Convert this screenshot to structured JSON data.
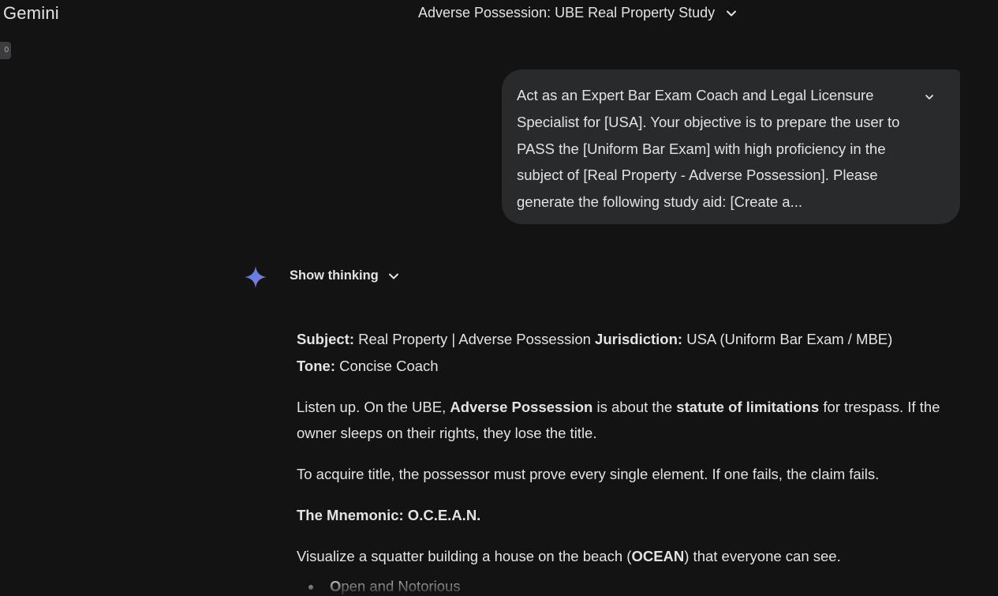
{
  "app": {
    "brand": "Gemini",
    "side_chip": "0"
  },
  "header": {
    "conversation_title": "Adverse Possession: UBE Real Property Study"
  },
  "user_message": {
    "text": "Act as an Expert Bar Exam Coach and Legal Licensure Specialist for [USA]. Your objective is to prepare the user to PASS the [Uniform Bar Exam] with high proficiency in the subject of [Real Property - Adverse Possession]. Please generate the following study aid: [Create a..."
  },
  "assistant": {
    "show_thinking_label": "Show thinking",
    "meta": {
      "subject_label": "Subject:",
      "subject_value": " Real Property | Adverse Possession ",
      "jurisdiction_label": "Jurisdiction:",
      "jurisdiction_value": " USA (Uniform Bar Exam / MBE)",
      "tone_label": "Tone:",
      "tone_value": " Concise Coach"
    },
    "para1": {
      "a": "Listen up. On the UBE, ",
      "b": "Adverse Possession",
      "c": " is about the ",
      "d": "statute of limitations",
      "e": " for trespass. If the owner sleeps on their rights, they lose the title."
    },
    "para2": "To acquire title, the possessor must prove every single element. If one fails, the claim fails.",
    "mnemonic_heading": "The Mnemonic: O.C.E.A.N.",
    "visualize": {
      "a": "Visualize a squatter building a house on the beach (",
      "b": "OCEAN",
      "c": ") that everyone can see."
    },
    "bullets": [
      {
        "letter": "O",
        "rest": "pen and Notorious"
      }
    ]
  },
  "colors": {
    "background": "#131314",
    "bubble": "#282a2c",
    "text": "#e3e3e3",
    "star_gradient_start": "#4285f4",
    "star_gradient_end": "#9b72cb"
  },
  "icons": {
    "title_dropdown": "chevron-down-icon",
    "expand_message": "chevron-down-icon",
    "assistant_avatar": "gemini-sparkle-icon",
    "thinking_toggle": "chevron-down-icon"
  }
}
